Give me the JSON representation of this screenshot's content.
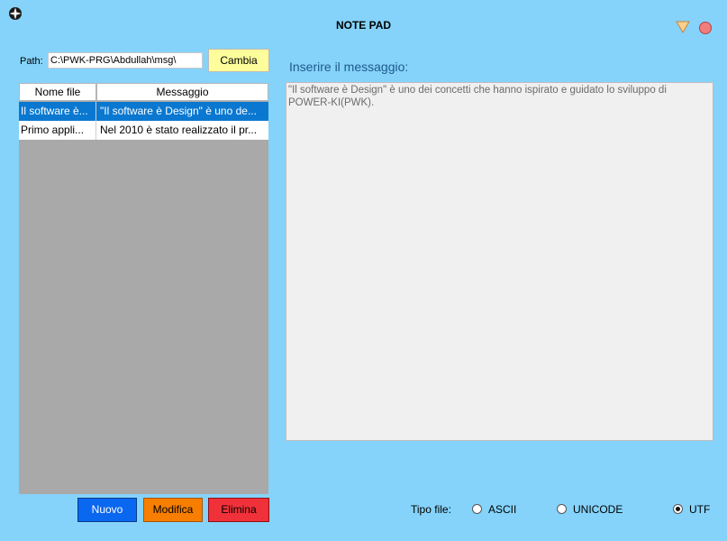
{
  "window": {
    "title": "NOTE PAD"
  },
  "icons": {
    "app": "aperture-icon",
    "minimize": "triangle-down-icon",
    "close": "red-circle-icon"
  },
  "path": {
    "label": "Path:",
    "value": "C:\\PWK-PRG\\Abdullah\\msg\\",
    "button_label": "Cambia"
  },
  "file_table": {
    "columns": [
      "Nome file",
      "Messaggio"
    ],
    "rows": [
      {
        "name": "Il software è...",
        "message": "\"Il software è Design\" è uno de...",
        "selected": true
      },
      {
        "name": "Primo appli...",
        "message": "Nel 2010 è stato realizzato il pr...",
        "selected": false
      }
    ]
  },
  "message": {
    "label": "Inserire il messaggio:",
    "value": "\"Il software è Design\" è uno dei concetti che hanno ispirato e guidato lo sviluppo di POWER-KI(PWK)."
  },
  "actions": {
    "new": "Nuovo",
    "edit": "Modifica",
    "delete": "Elimina"
  },
  "file_type": {
    "label": "Tipo file:",
    "options": [
      "ASCII",
      "UNICODE",
      "UTF"
    ],
    "selected": "UTF"
  },
  "colors": {
    "background": "#85d3fb",
    "cambia": "#fdfd9c",
    "nuovo": "#0a67f0",
    "modifica": "#f77e00",
    "elimina": "#f0313a",
    "selection": "#0a78d0"
  }
}
